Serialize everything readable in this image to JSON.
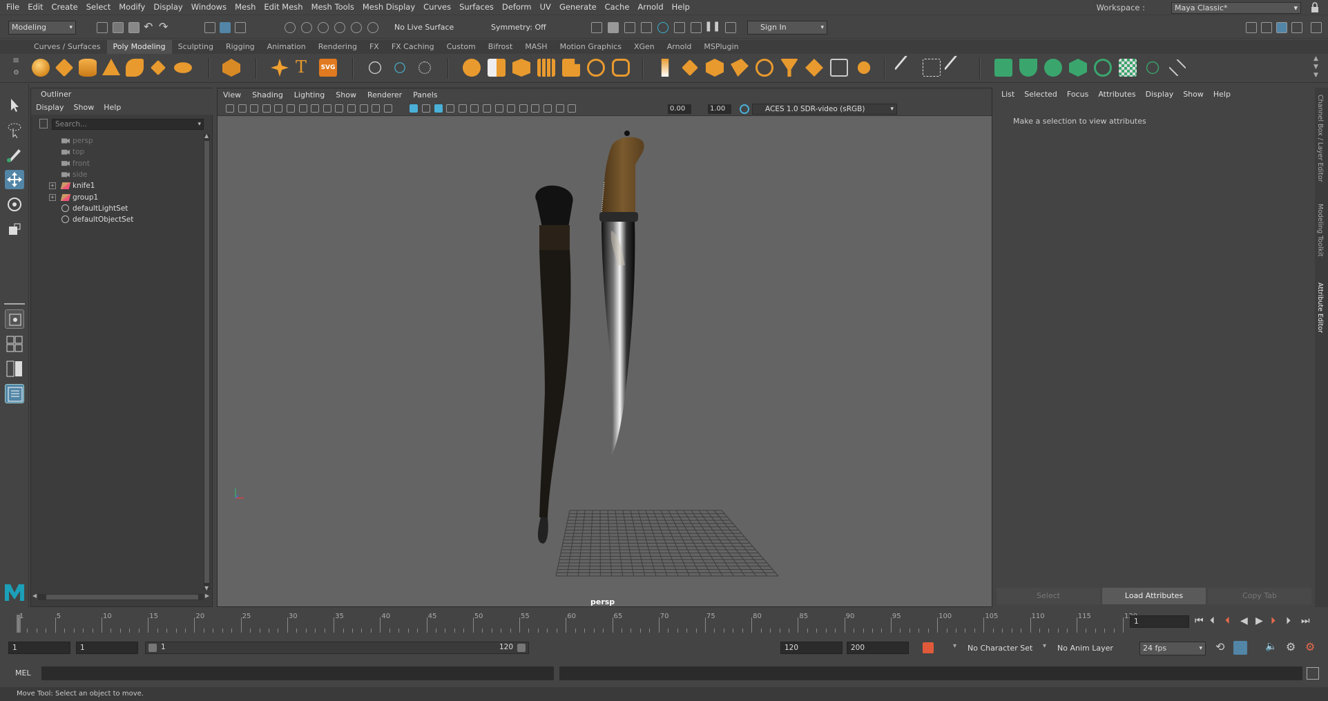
{
  "menubar": {
    "items": [
      "File",
      "Edit",
      "Create",
      "Select",
      "Modify",
      "Display",
      "Windows",
      "Mesh",
      "Edit Mesh",
      "Mesh Tools",
      "Mesh Display",
      "Curves",
      "Surfaces",
      "Deform",
      "UV",
      "Generate",
      "Cache",
      "Arnold",
      "Help"
    ],
    "workspace_label": "Workspace :",
    "workspace_value": "Maya Classic*"
  },
  "statusline": {
    "menuset": "Modeling",
    "live_surface": "No Live Surface",
    "symmetry": "Symmetry: Off",
    "sign_in": "Sign In"
  },
  "shelf": {
    "tabs": [
      "Curves / Surfaces",
      "Poly Modeling",
      "Sculpting",
      "Rigging",
      "Animation",
      "Rendering",
      "FX",
      "FX Caching",
      "Custom",
      "Bifrost",
      "MASH",
      "Motion Graphics",
      "XGen",
      "Arnold",
      "MSPlugin"
    ],
    "active_tab": "Poly Modeling",
    "svg_icon_label": "SVG"
  },
  "outliner": {
    "title": "Outliner",
    "menu": [
      "Display",
      "Show",
      "Help"
    ],
    "search_placeholder": "Search...",
    "items": [
      {
        "label": "persp",
        "type": "camera",
        "dim": true,
        "expandable": false
      },
      {
        "label": "top",
        "type": "camera",
        "dim": true,
        "expandable": false
      },
      {
        "label": "front",
        "type": "camera",
        "dim": true,
        "expandable": false
      },
      {
        "label": "side",
        "type": "camera",
        "dim": true,
        "expandable": false
      },
      {
        "label": "knife1",
        "type": "transform",
        "dim": false,
        "expandable": true
      },
      {
        "label": "group1",
        "type": "transform",
        "dim": false,
        "expandable": true
      },
      {
        "label": "defaultLightSet",
        "type": "set",
        "dim": false,
        "expandable": false
      },
      {
        "label": "defaultObjectSet",
        "type": "set",
        "dim": false,
        "expandable": false
      }
    ]
  },
  "viewport": {
    "menu": [
      "View",
      "Shading",
      "Lighting",
      "Show",
      "Renderer",
      "Panels"
    ],
    "exposure": "0.00",
    "gamma": "1.00",
    "color_management": "ACES 1.0 SDR-video (sRGB)",
    "camera_label": "persp"
  },
  "attribute_editor": {
    "menu": [
      "List",
      "Selected",
      "Focus",
      "Attributes",
      "Display",
      "Show",
      "Help"
    ],
    "message": "Make a selection to view attributes",
    "buttons": {
      "select": "Select",
      "load": "Load Attributes",
      "copy": "Copy Tab"
    }
  },
  "side_tabs": [
    "Channel Box / Layer Editor",
    "Modeling Toolkit",
    "Attribute Editor"
  ],
  "timeslider": {
    "tick_labels": [
      "1",
      "5",
      "10",
      "15",
      "20",
      "25",
      "30",
      "35",
      "40",
      "45",
      "50",
      "55",
      "60",
      "65",
      "70",
      "75",
      "80",
      "85",
      "90",
      "95",
      "100",
      "105",
      "110",
      "115",
      "120"
    ],
    "current_frame": "1"
  },
  "range": {
    "start": "1",
    "playback_start": "1",
    "range_start_label": "1",
    "range_end_label": "120",
    "playback_end": "120",
    "end": "200",
    "character_set": "No Character Set",
    "anim_layer": "No Anim Layer",
    "fps": "24 fps"
  },
  "command_line": {
    "mel": "MEL"
  },
  "help_line": "Move Tool: Select an object to move.",
  "colors": {
    "accent": "#5285a6",
    "shelf_orange": "#e8a23a",
    "shelf_green": "#3aa66e",
    "maya_logo": "#1c9fb8"
  }
}
